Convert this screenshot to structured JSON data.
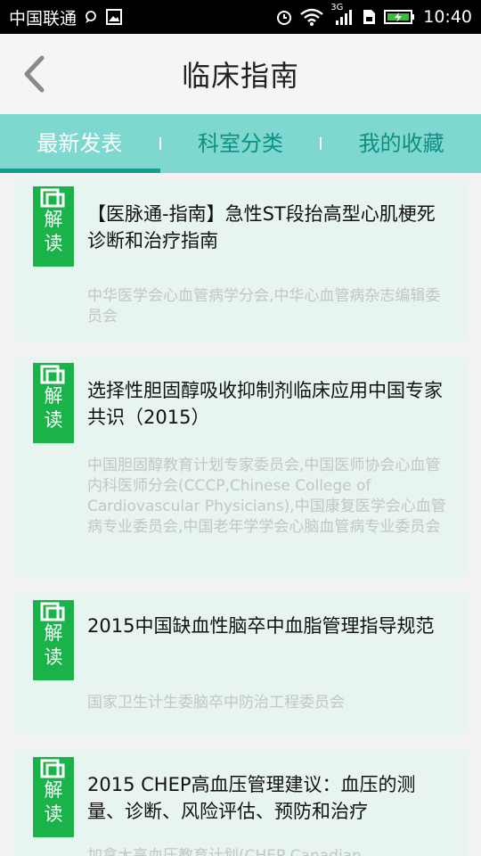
{
  "status_bar": {
    "carrier": "中国联通",
    "network_type": "3G",
    "time": "10:40",
    "icons": [
      "chat-bubble-icon",
      "image-icon",
      "alarm-icon",
      "wifi-icon",
      "signal-icon",
      "sim-icon",
      "battery-charging-icon"
    ]
  },
  "header": {
    "title": "临床指南",
    "back_icon": "chevron-left-icon"
  },
  "tabs": [
    {
      "label": "最新发表",
      "active": true
    },
    {
      "label": "科室分类",
      "active": false
    },
    {
      "label": "我的收藏",
      "active": false
    }
  ],
  "colors": {
    "tab_bar": "#7fd8cf",
    "tab_text": "#0e8f86",
    "tab_indicator": "#0aa195",
    "badge": "#1ab34a",
    "card_bg": "#e8f4f0"
  },
  "guides": [
    {
      "badge_line1": "解",
      "badge_line2": "读",
      "title": "【医脉通-指南】急性ST段抬高型心肌梗死诊断和治疗指南",
      "source": "中华医学会心血管病学分会,中华心血管病杂志编辑委员会"
    },
    {
      "badge_line1": "解",
      "badge_line2": "读",
      "title": "选择性胆固醇吸收抑制剂临床应用中国专家共识（2015）",
      "source": "中国胆固醇教育计划专家委员会,中国医师协会心血管内科医师分会(CCCP,Chinese College of Cardiovascular Physicians),中国康复医学会心血管病专业委员会,中国老年学学会心脑血管病专业委员会"
    },
    {
      "badge_line1": "解",
      "badge_line2": "读",
      "title": "2015中国缺血性脑卒中血脂管理指导规范",
      "source": "国家卫生计生委脑卒中防治工程委员会"
    },
    {
      "badge_line1": "解",
      "badge_line2": "读",
      "title": "2015 CHEP高血压管理建议：血压的测量、诊断、风险评估、预防和治疗",
      "source": "加拿大高血压教育计划(CHEP Canadian"
    }
  ]
}
